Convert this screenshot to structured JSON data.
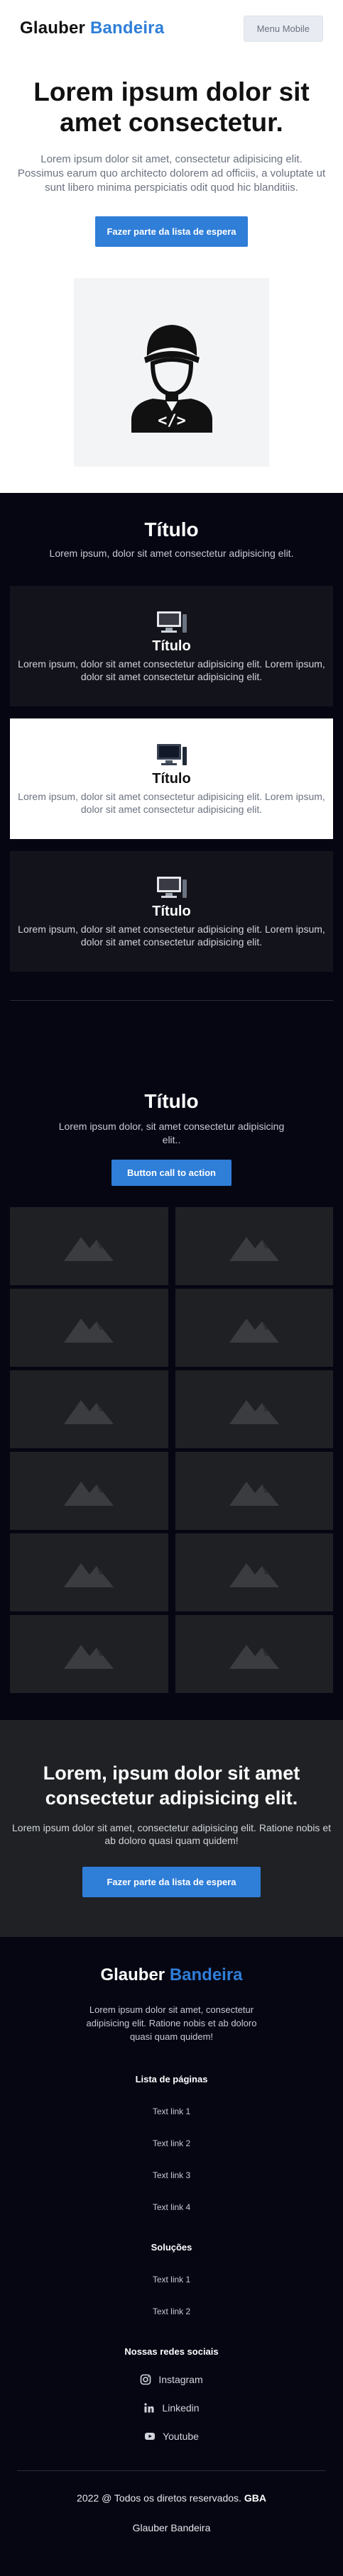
{
  "header": {
    "brand_part1": "Glauber",
    "brand_part2": "Bandeira",
    "menu_button": "Menu Mobile"
  },
  "hero": {
    "title": "Lorem ipsum dolor sit amet consectetur.",
    "description": "Lorem ipsum dolor sit amet, consectetur adipisicing elit. Possimus earum quo architecto dolorem ad officiis, a voluptate ut sunt libero minima perspiciatis odit quod hic blanditiis.",
    "cta": "Fazer parte da lista de espera"
  },
  "features": {
    "title": "Título",
    "subtitle": "Lorem ipsum, dolor sit amet consectetur adipisicing elit.",
    "cards": [
      {
        "icon": "computer-icon",
        "title": "Título",
        "desc": "Lorem ipsum, dolor sit amet consectetur adipisicing elit. Lorem ipsum, dolor sit amet consectetur adipisicing elit."
      },
      {
        "icon": "computer-icon",
        "title": "Título",
        "desc": "Lorem ipsum, dolor sit amet consectetur adipisicing elit. Lorem ipsum, dolor sit amet consectetur adipisicing elit."
      },
      {
        "icon": "computer-icon",
        "title": "Título",
        "desc": "Lorem ipsum, dolor sit amet consectetur adipisicing elit. Lorem ipsum, dolor sit amet consectetur adipisicing elit."
      }
    ]
  },
  "gallery": {
    "title": "Título",
    "subtitle": "Lorem ipsum dolor, sit amet consectetur adipisicing elit..",
    "button": "Button call to action",
    "tile_icon": "image-placeholder-icon",
    "tile_count": 12
  },
  "cta_band": {
    "title": "Lorem, ipsum dolor sit amet consectetur adipisicing elit.",
    "description": "Lorem ipsum dolor sit amet, consectetur adipisicing elit. Ratione nobis et ab doloro quasi quam quidem!",
    "button": "Fazer parte da lista de espera"
  },
  "footer": {
    "brand_part1": "Glauber",
    "brand_part2": "Bandeira",
    "description": "Lorem ipsum dolor sit amet, consectetur adipisicing elit. Ratione nobis et ab doloro quasi quam quidem!",
    "pages_heading": "Lista de páginas",
    "pages_links": [
      "Text link 1",
      "Text link 2",
      "Text link 3",
      "Text link 4"
    ],
    "solutions_heading": "Soluções",
    "solutions_links": [
      "Text link 1",
      "Text link 2"
    ],
    "social_heading": "Nossas redes sociais",
    "social": [
      {
        "icon": "instagram-icon",
        "label": "Instagram"
      },
      {
        "icon": "linkedin-icon",
        "label": "Linkedin"
      },
      {
        "icon": "youtube-icon",
        "label": "Youtube"
      }
    ],
    "copyright": "2022 @ Todos os diretos reservados.",
    "copyright_brand": "GBA",
    "author": "Glauber Bandeira"
  },
  "colors": {
    "accent": "#2f7ed8",
    "dark_bg": "#060613",
    "card_bg": "#13131c",
    "band_bg": "#1f2124",
    "tile_bg": "#1f2023"
  }
}
